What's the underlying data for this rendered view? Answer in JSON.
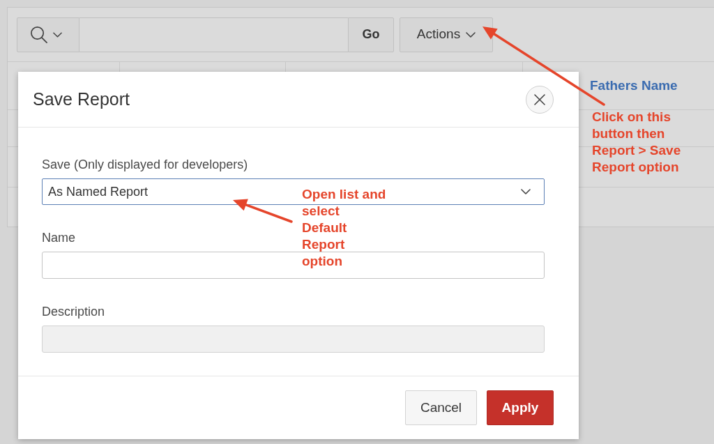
{
  "toolbar": {
    "go_button": "Go",
    "actions_button": "Actions"
  },
  "report": {
    "column_4_header": "Fathers Name"
  },
  "dialog": {
    "title": "Save Report",
    "fields": [
      {
        "kind": "select",
        "label": "Save (Only displayed for developers)",
        "value": "As Named Report",
        "focused": true,
        "disabled": false
      },
      {
        "kind": "text",
        "label": "Name",
        "focused": false,
        "disabled": false
      },
      {
        "kind": "text",
        "label": "Description",
        "focused": false,
        "disabled": true
      }
    ],
    "buttons": [
      {
        "kind": "secondary",
        "label": "Cancel"
      },
      {
        "kind": "primary",
        "label": "Apply"
      }
    ]
  },
  "annotations": [
    {
      "kind": "callout",
      "text": "Click on this\nbutton then\nReport > Save\nReport option"
    },
    {
      "kind": "callout",
      "text": "Open list and\nselect\nDefault\nReport\noption"
    }
  ]
}
